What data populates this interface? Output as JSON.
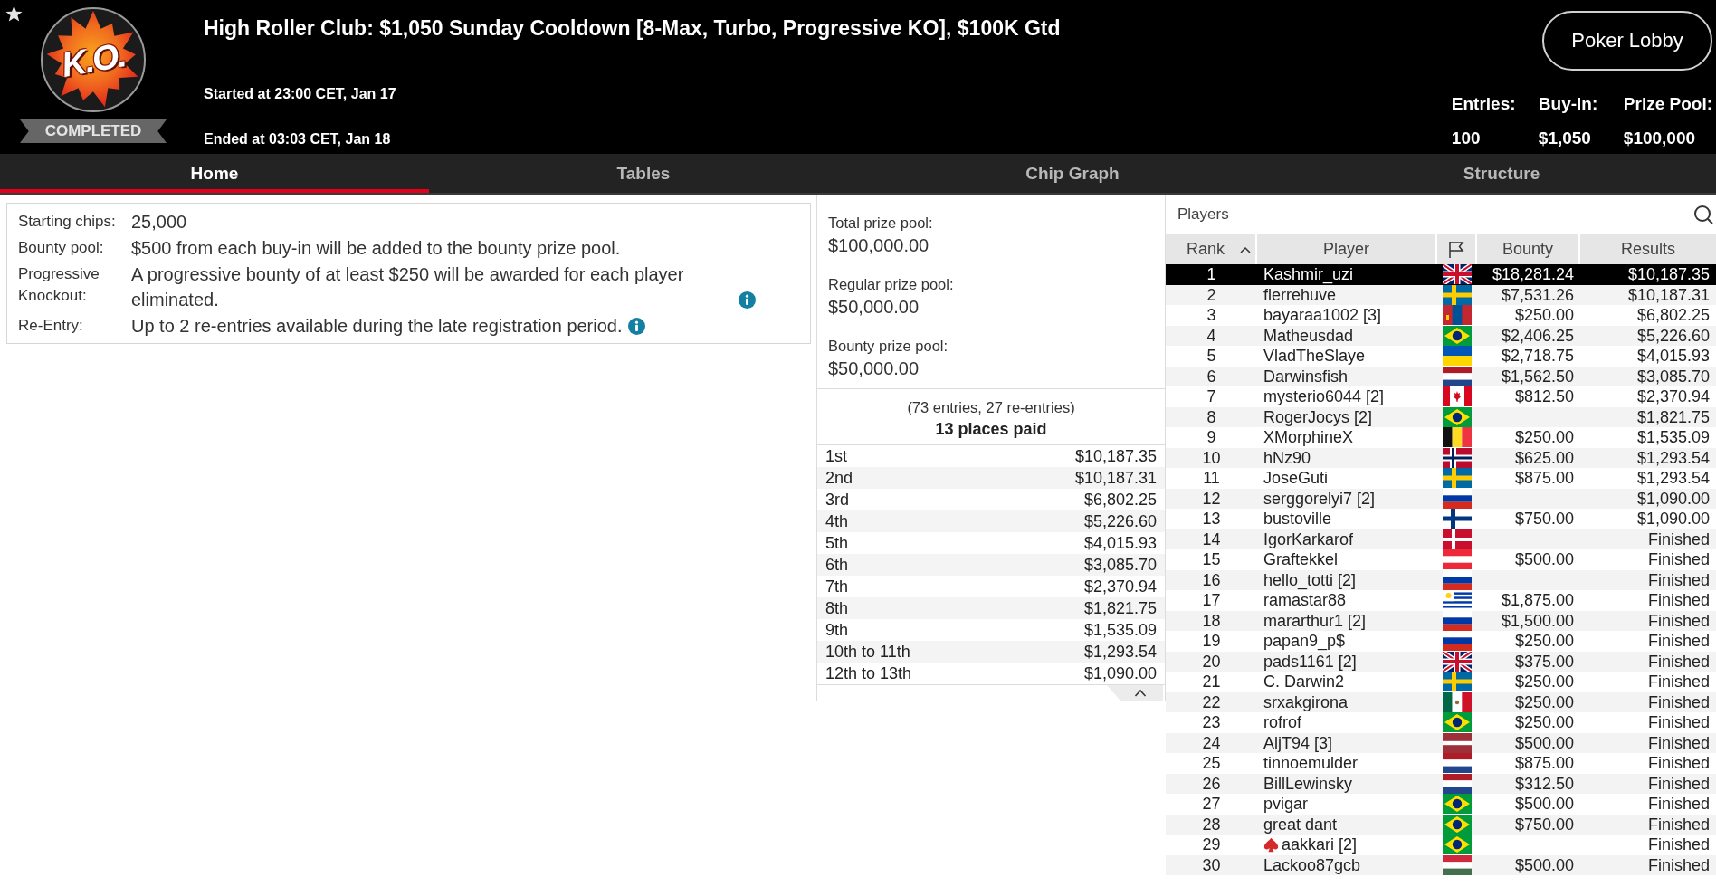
{
  "header": {
    "logo_text": "K.O.",
    "status": "COMPLETED",
    "title": "High Roller Club: $1,050 Sunday Cooldown [8-Max, Turbo, Progressive KO], $100K Gtd",
    "started": "Started at 23:00 CET, Jan 17",
    "ended": "Ended at 03:03 CET, Jan 18",
    "lobby_button": "Poker Lobby",
    "stats": [
      {
        "label": "Entries:",
        "value": "100"
      },
      {
        "label": "Buy-In:",
        "value": "$1,050"
      },
      {
        "label": "Prize Pool:",
        "value": "$100,000"
      }
    ]
  },
  "tabs": [
    {
      "label": "Home",
      "selected": true
    },
    {
      "label": "Tables",
      "selected": false
    },
    {
      "label": "Chip Graph",
      "selected": false
    },
    {
      "label": "Structure",
      "selected": false
    }
  ],
  "details": [
    {
      "label": "Starting chips:",
      "value": "25,000",
      "info": false
    },
    {
      "label": "Bounty pool:",
      "value": "$500 from each buy-in will be added to the bounty prize pool.",
      "info": false
    },
    {
      "label": "Progressive Knockout:",
      "value": "A progressive bounty of at least $250 will be awarded for each player eliminated.",
      "info": true
    },
    {
      "label": "Re-Entry:",
      "value": "Up to 2 re-entries available during the late registration period.",
      "info": true
    }
  ],
  "prize_pools": [
    {
      "label": "Total prize pool:",
      "value": "$100,000.00"
    },
    {
      "label": "Regular prize pool:",
      "value": "$50,000.00"
    },
    {
      "label": "Bounty prize pool:",
      "value": "$50,000.00"
    }
  ],
  "payouts": {
    "entries_note": "(73 entries, 27 re-entries)",
    "places_paid": "13 places paid",
    "rows": [
      {
        "place": "1st",
        "amount": "$10,187.35"
      },
      {
        "place": "2nd",
        "amount": "$10,187.31"
      },
      {
        "place": "3rd",
        "amount": "$6,802.25"
      },
      {
        "place": "4th",
        "amount": "$5,226.60"
      },
      {
        "place": "5th",
        "amount": "$4,015.93"
      },
      {
        "place": "6th",
        "amount": "$3,085.70"
      },
      {
        "place": "7th",
        "amount": "$2,370.94"
      },
      {
        "place": "8th",
        "amount": "$1,821.75"
      },
      {
        "place": "9th",
        "amount": "$1,535.09"
      },
      {
        "place": "10th to 11th",
        "amount": "$1,293.54"
      },
      {
        "place": "12th to 13th",
        "amount": "$1,090.00"
      }
    ]
  },
  "players": {
    "title": "Players",
    "columns": [
      {
        "kind": "text",
        "label": "Rank",
        "sorted": true
      },
      {
        "kind": "text",
        "label": "Player",
        "sorted": false
      },
      {
        "kind": "flag",
        "sorted": false
      },
      {
        "kind": "text",
        "label": "Bounty",
        "sorted": false
      },
      {
        "kind": "text",
        "label": "Results",
        "sorted": false
      }
    ],
    "rows": [
      {
        "rank": "1",
        "name": "Kashmir_uzi",
        "flag": {
          "kind": "gb"
        },
        "bounty": "$18,281.24",
        "result": "$10,187.35",
        "selected": true,
        "pro_badge": false
      },
      {
        "rank": "2",
        "name": "flerrehuve",
        "flag": {
          "kind": "se"
        },
        "bounty": "$7,531.26",
        "result": "$10,187.31",
        "selected": false,
        "pro_badge": false
      },
      {
        "rank": "3",
        "name": "bayaraa1002 [3]",
        "flag": {
          "kind": "mn"
        },
        "bounty": "$250.00",
        "result": "$6,802.25",
        "selected": false,
        "pro_badge": false
      },
      {
        "rank": "4",
        "name": "Matheusdad",
        "flag": {
          "kind": "br"
        },
        "bounty": "$2,406.25",
        "result": "$5,226.60",
        "selected": false,
        "pro_badge": false
      },
      {
        "rank": "5",
        "name": "VladTheSlaye",
        "flag": {
          "kind": "ua"
        },
        "bounty": "$2,718.75",
        "result": "$4,015.93",
        "selected": false,
        "pro_badge": false
      },
      {
        "rank": "6",
        "name": "Darwinsfish",
        "flag": {
          "kind": "nl"
        },
        "bounty": "$1,562.50",
        "result": "$3,085.70",
        "selected": false,
        "pro_badge": false
      },
      {
        "rank": "7",
        "name": "mysterio6044 [2]",
        "flag": {
          "kind": "ca"
        },
        "bounty": "$812.50",
        "result": "$2,370.94",
        "selected": false,
        "pro_badge": false
      },
      {
        "rank": "8",
        "name": "RogerJocys [2]",
        "flag": {
          "kind": "br"
        },
        "result": "$1,821.75",
        "selected": false,
        "pro_badge": false
      },
      {
        "rank": "9",
        "name": "XMorphineX",
        "flag": {
          "kind": "be"
        },
        "bounty": "$250.00",
        "result": "$1,535.09",
        "selected": false,
        "pro_badge": false
      },
      {
        "rank": "10",
        "name": "hNz90",
        "flag": {
          "kind": "no"
        },
        "bounty": "$625.00",
        "result": "$1,293.54",
        "selected": false,
        "pro_badge": false
      },
      {
        "rank": "11",
        "name": "JoseGuti",
        "flag": {
          "kind": "se"
        },
        "bounty": "$875.00",
        "result": "$1,293.54",
        "selected": false,
        "pro_badge": false
      },
      {
        "rank": "12",
        "name": "serggorelyi7 [2]",
        "flag": {
          "kind": "ru"
        },
        "result": "$1,090.00",
        "selected": false,
        "pro_badge": false
      },
      {
        "rank": "13",
        "name": "bustoville",
        "flag": {
          "kind": "fi"
        },
        "bounty": "$750.00",
        "result": "$1,090.00",
        "selected": false,
        "pro_badge": false
      },
      {
        "rank": "14",
        "name": "IgorKarkarof",
        "flag": {
          "kind": "dk"
        },
        "result": "Finished",
        "selected": false,
        "pro_badge": false
      },
      {
        "rank": "15",
        "name": "Graftekkel",
        "flag": {
          "kind": "at"
        },
        "bounty": "$500.00",
        "result": "Finished",
        "selected": false,
        "pro_badge": false
      },
      {
        "rank": "16",
        "name": "hello_totti [2]",
        "flag": {
          "kind": "ru"
        },
        "result": "Finished",
        "selected": false,
        "pro_badge": false
      },
      {
        "rank": "17",
        "name": "ramastar88",
        "flag": {
          "kind": "uy"
        },
        "bounty": "$1,875.00",
        "result": "Finished",
        "selected": false,
        "pro_badge": false
      },
      {
        "rank": "18",
        "name": "mararthur1 [2]",
        "flag": {
          "kind": "ru"
        },
        "bounty": "$1,500.00",
        "result": "Finished",
        "selected": false,
        "pro_badge": false
      },
      {
        "rank": "19",
        "name": "papan9_p$",
        "flag": {
          "kind": "ru"
        },
        "bounty": "$250.00",
        "result": "Finished",
        "selected": false,
        "pro_badge": false
      },
      {
        "rank": "20",
        "name": "pads1161 [2]",
        "flag": {
          "kind": "gb"
        },
        "bounty": "$375.00",
        "result": "Finished",
        "selected": false,
        "pro_badge": false
      },
      {
        "rank": "21",
        "name": "C. Darwin2",
        "flag": {
          "kind": "se"
        },
        "bounty": "$250.00",
        "result": "Finished",
        "selected": false,
        "pro_badge": false
      },
      {
        "rank": "22",
        "name": "srxakgirona",
        "flag": {
          "kind": "mx"
        },
        "bounty": "$250.00",
        "result": "Finished",
        "selected": false,
        "pro_badge": false
      },
      {
        "rank": "23",
        "name": "rofrof",
        "flag": {
          "kind": "br"
        },
        "bounty": "$250.00",
        "result": "Finished",
        "selected": false,
        "pro_badge": false
      },
      {
        "rank": "24",
        "name": "AljT94 [3]",
        "flag": {
          "kind": "lv"
        },
        "bounty": "$500.00",
        "result": "Finished",
        "selected": false,
        "pro_badge": false
      },
      {
        "rank": "25",
        "name": "tinnoemulder",
        "flag": {
          "kind": "nl"
        },
        "bounty": "$875.00",
        "result": "Finished",
        "selected": false,
        "pro_badge": false
      },
      {
        "rank": "26",
        "name": "BillLewinsky",
        "flag": {
          "kind": "nl"
        },
        "bounty": "$312.50",
        "result": "Finished",
        "selected": false,
        "pro_badge": false
      },
      {
        "rank": "27",
        "name": "pvigar",
        "flag": {
          "kind": "br"
        },
        "bounty": "$500.00",
        "result": "Finished",
        "selected": false,
        "pro_badge": false
      },
      {
        "rank": "28",
        "name": "great dant",
        "flag": {
          "kind": "br"
        },
        "bounty": "$750.00",
        "result": "Finished",
        "selected": false,
        "pro_badge": false
      },
      {
        "rank": "29",
        "name": "aakkari [2]",
        "flag": {
          "kind": "br"
        },
        "result": "Finished",
        "selected": false,
        "pro_badge": true
      },
      {
        "rank": "30",
        "name": "Lackoo87gcb",
        "flag": {
          "kind": "hu"
        },
        "bounty": "$500.00",
        "result": "Finished",
        "selected": false,
        "pro_badge": false
      }
    ]
  }
}
